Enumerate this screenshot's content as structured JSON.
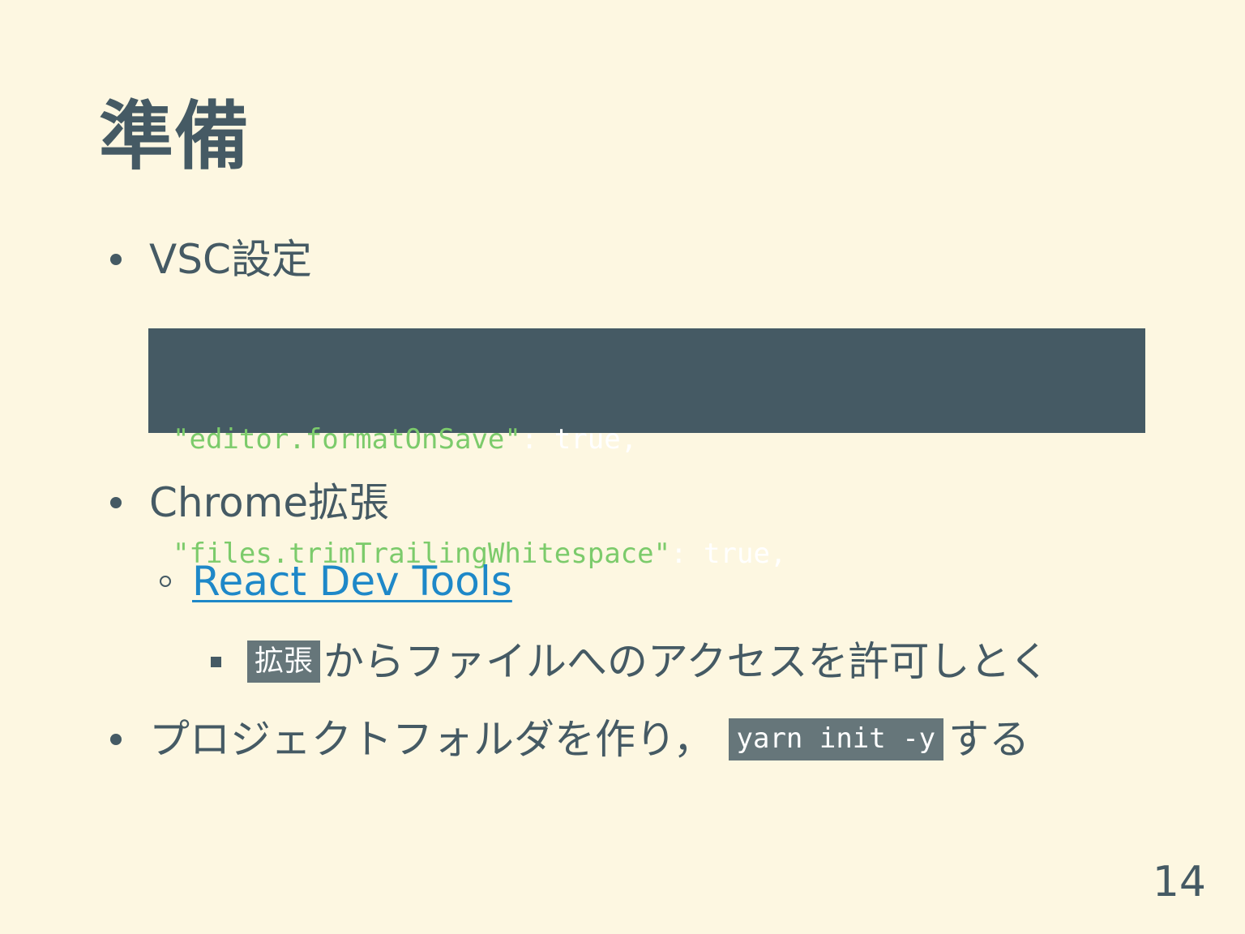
{
  "slide": {
    "title": "準備",
    "bullets": {
      "vsc": "VSC設定",
      "chrome": "Chrome拡張",
      "project_before": "プロジェクトフォルダを作り，",
      "project_code": "yarn init -y",
      "project_after": "する"
    },
    "code": {
      "line1": {
        "key": "\"editor.formatOnSave\"",
        "suffix": ": true,"
      },
      "line2": {
        "key": "\"files.trimTrailingWhitespace\"",
        "suffix": ": true,"
      }
    },
    "link": {
      "text": "React Dev Tools"
    },
    "extension_note": {
      "highlight": "拡張",
      "text": "からファイルへのアクセスを許可しとく"
    },
    "page_number": "14"
  },
  "colors": {
    "background": "#fdf7e1",
    "text": "#455a64",
    "code_background": "#455a64",
    "code_string": "#7ccb6b",
    "link": "#1e88c8",
    "inline_code_background": "#66767a"
  }
}
